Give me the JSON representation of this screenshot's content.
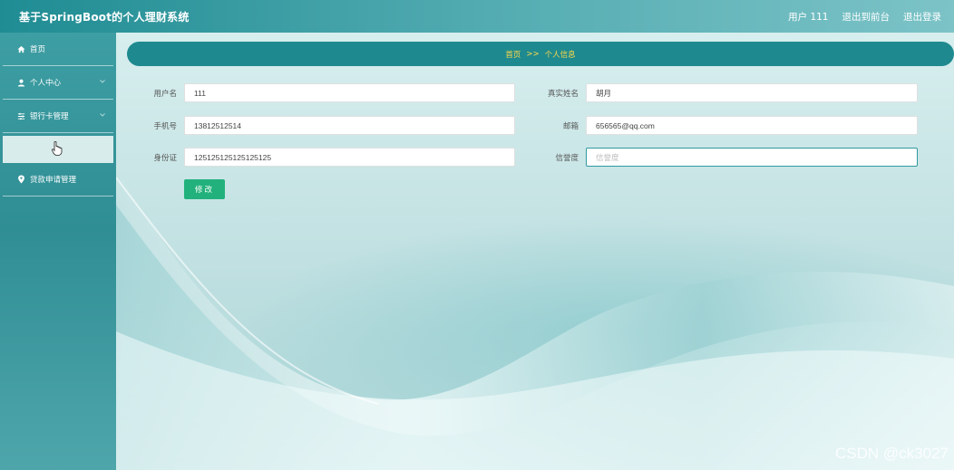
{
  "header": {
    "title": "基于SpringBoot的个人理财系统",
    "user_label": "用户 111",
    "front_label": "退出到前台",
    "logout_label": "退出登录"
  },
  "sidebar": {
    "items": [
      {
        "label": "首页",
        "icon": "home-icon"
      },
      {
        "label": "个人中心",
        "icon": "user-icon"
      },
      {
        "label": "银行卡管理",
        "icon": "sliders-icon"
      },
      {
        "label": "贷款申请管理",
        "icon": "location-pin-icon"
      }
    ]
  },
  "breadcrumb": {
    "home": "首页",
    "separator": ">>",
    "current": "个人信息"
  },
  "form": {
    "username_label": "用户名",
    "username_value": "111",
    "realname_label": "真实姓名",
    "realname_value": "胡月",
    "phone_label": "手机号",
    "phone_value": "13812512514",
    "email_label": "邮箱",
    "email_value": "656565@qq.com",
    "idcard_label": "身份证",
    "idcard_value": "125125125125125125",
    "credit_label": "信誉度",
    "credit_placeholder": "信誉度",
    "submit_label": "修改"
  },
  "watermark": "CSDN @ck3027",
  "colors": {
    "header_start": "#1f8c93",
    "sidebar": "#2f8e94",
    "breadcrumb_bg": "#1e8a8f",
    "breadcrumb_text": "#ffd84a",
    "submit_button": "#22b17c"
  }
}
